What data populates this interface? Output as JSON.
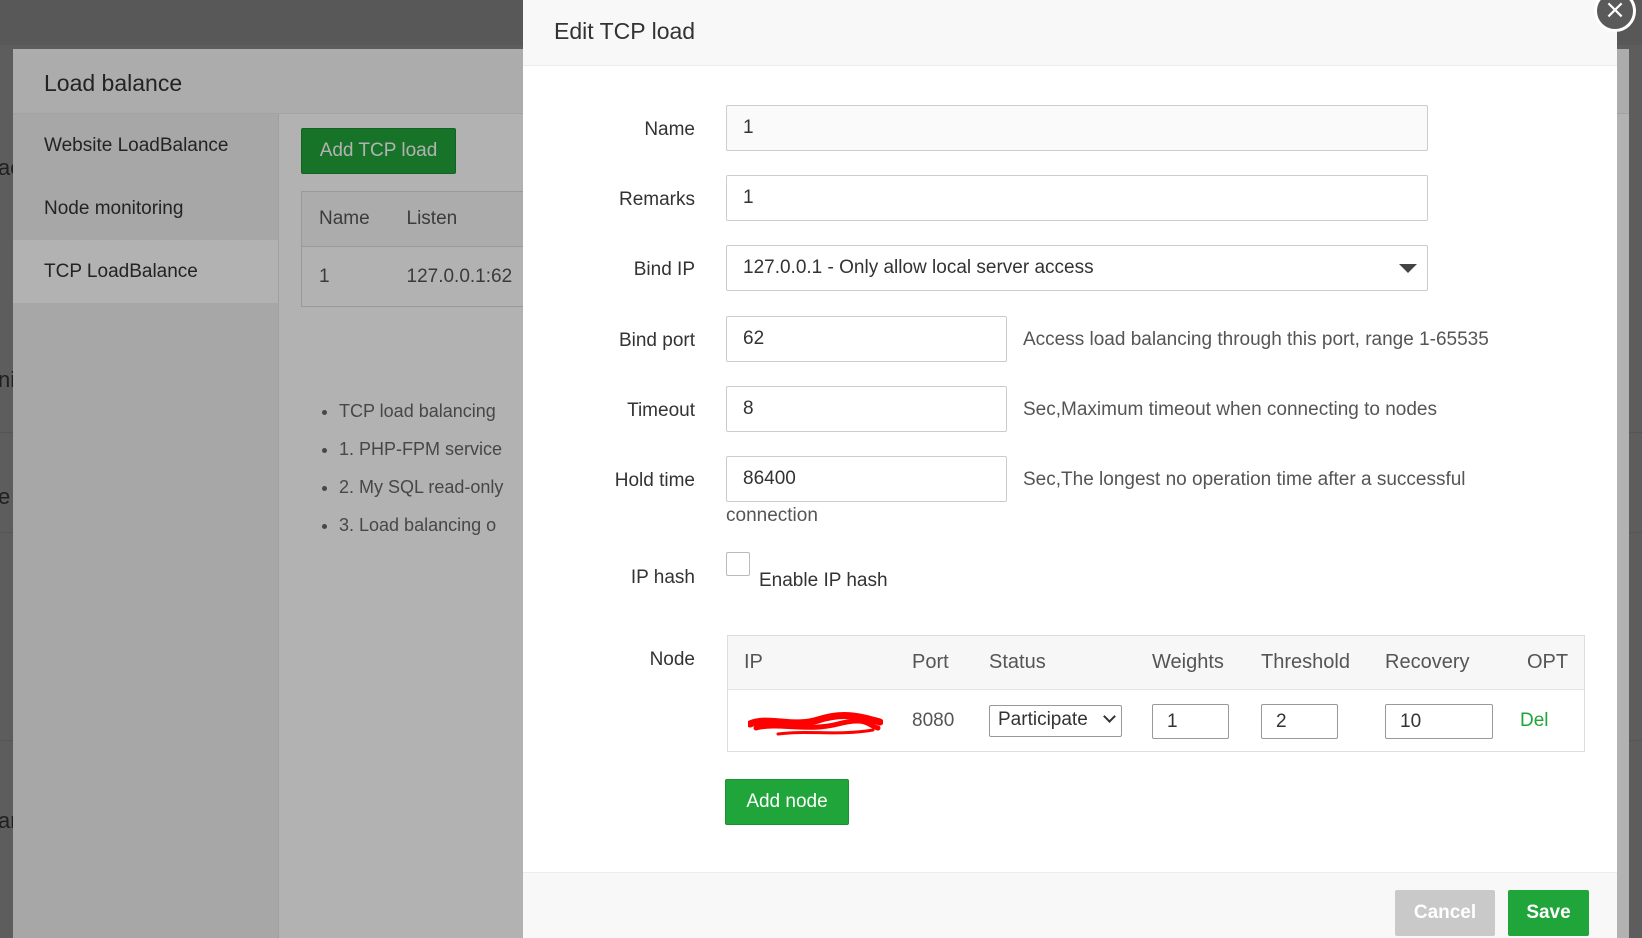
{
  "background": {
    "fragments": [
      "ac",
      "ni",
      "e",
      "ar"
    ]
  },
  "load_balance": {
    "title": "Load balance",
    "sidebar": [
      {
        "label": "Website LoadBalance"
      },
      {
        "label": "Node monitoring"
      },
      {
        "label": "TCP LoadBalance"
      }
    ],
    "add_button": "Add TCP load",
    "table": {
      "headers": [
        "Name",
        "Listen"
      ],
      "rows": [
        [
          "1",
          "127.0.0.1:62"
        ]
      ]
    },
    "notes": [
      "TCP load balancing",
      "1. PHP-FPM service",
      "2. My SQL read-only",
      "3. Load balancing o"
    ]
  },
  "dialog": {
    "title": "Edit TCP load",
    "close_symbol": "×",
    "fields": {
      "name": {
        "label": "Name",
        "value": "1"
      },
      "remarks": {
        "label": "Remarks",
        "value": "1"
      },
      "bind_ip": {
        "label": "Bind IP",
        "value": "127.0.0.1 - Only allow local server access"
      },
      "bind_port": {
        "label": "Bind port",
        "value": "62",
        "hint": "Access load balancing through this port, range 1-65535"
      },
      "timeout": {
        "label": "Timeout",
        "value": "8",
        "hint": "Sec,Maximum timeout when connecting to nodes"
      },
      "hold_time": {
        "label": "Hold time",
        "value": "86400",
        "hint": "Sec,The longest no operation time after a successful",
        "hint_cont": "connection"
      },
      "ip_hash": {
        "label": "IP hash",
        "checkbox_label": "Enable IP hash",
        "checked": false
      }
    },
    "node": {
      "label": "Node",
      "headers": [
        "IP",
        "Port",
        "Status",
        "Weights",
        "Threshold",
        "Recovery",
        "OPT"
      ],
      "rows": [
        {
          "port": "8080",
          "status": "Participate",
          "weights": "1",
          "threshold": "2",
          "recovery": "10",
          "action": "Del"
        }
      ],
      "add_button": "Add node"
    },
    "footer": {
      "cancel": "Cancel",
      "save": "Save"
    }
  },
  "colors": {
    "accent": "#20a53a",
    "cancel_bg": "#c9c9c9",
    "redaction": "#ff0000"
  }
}
